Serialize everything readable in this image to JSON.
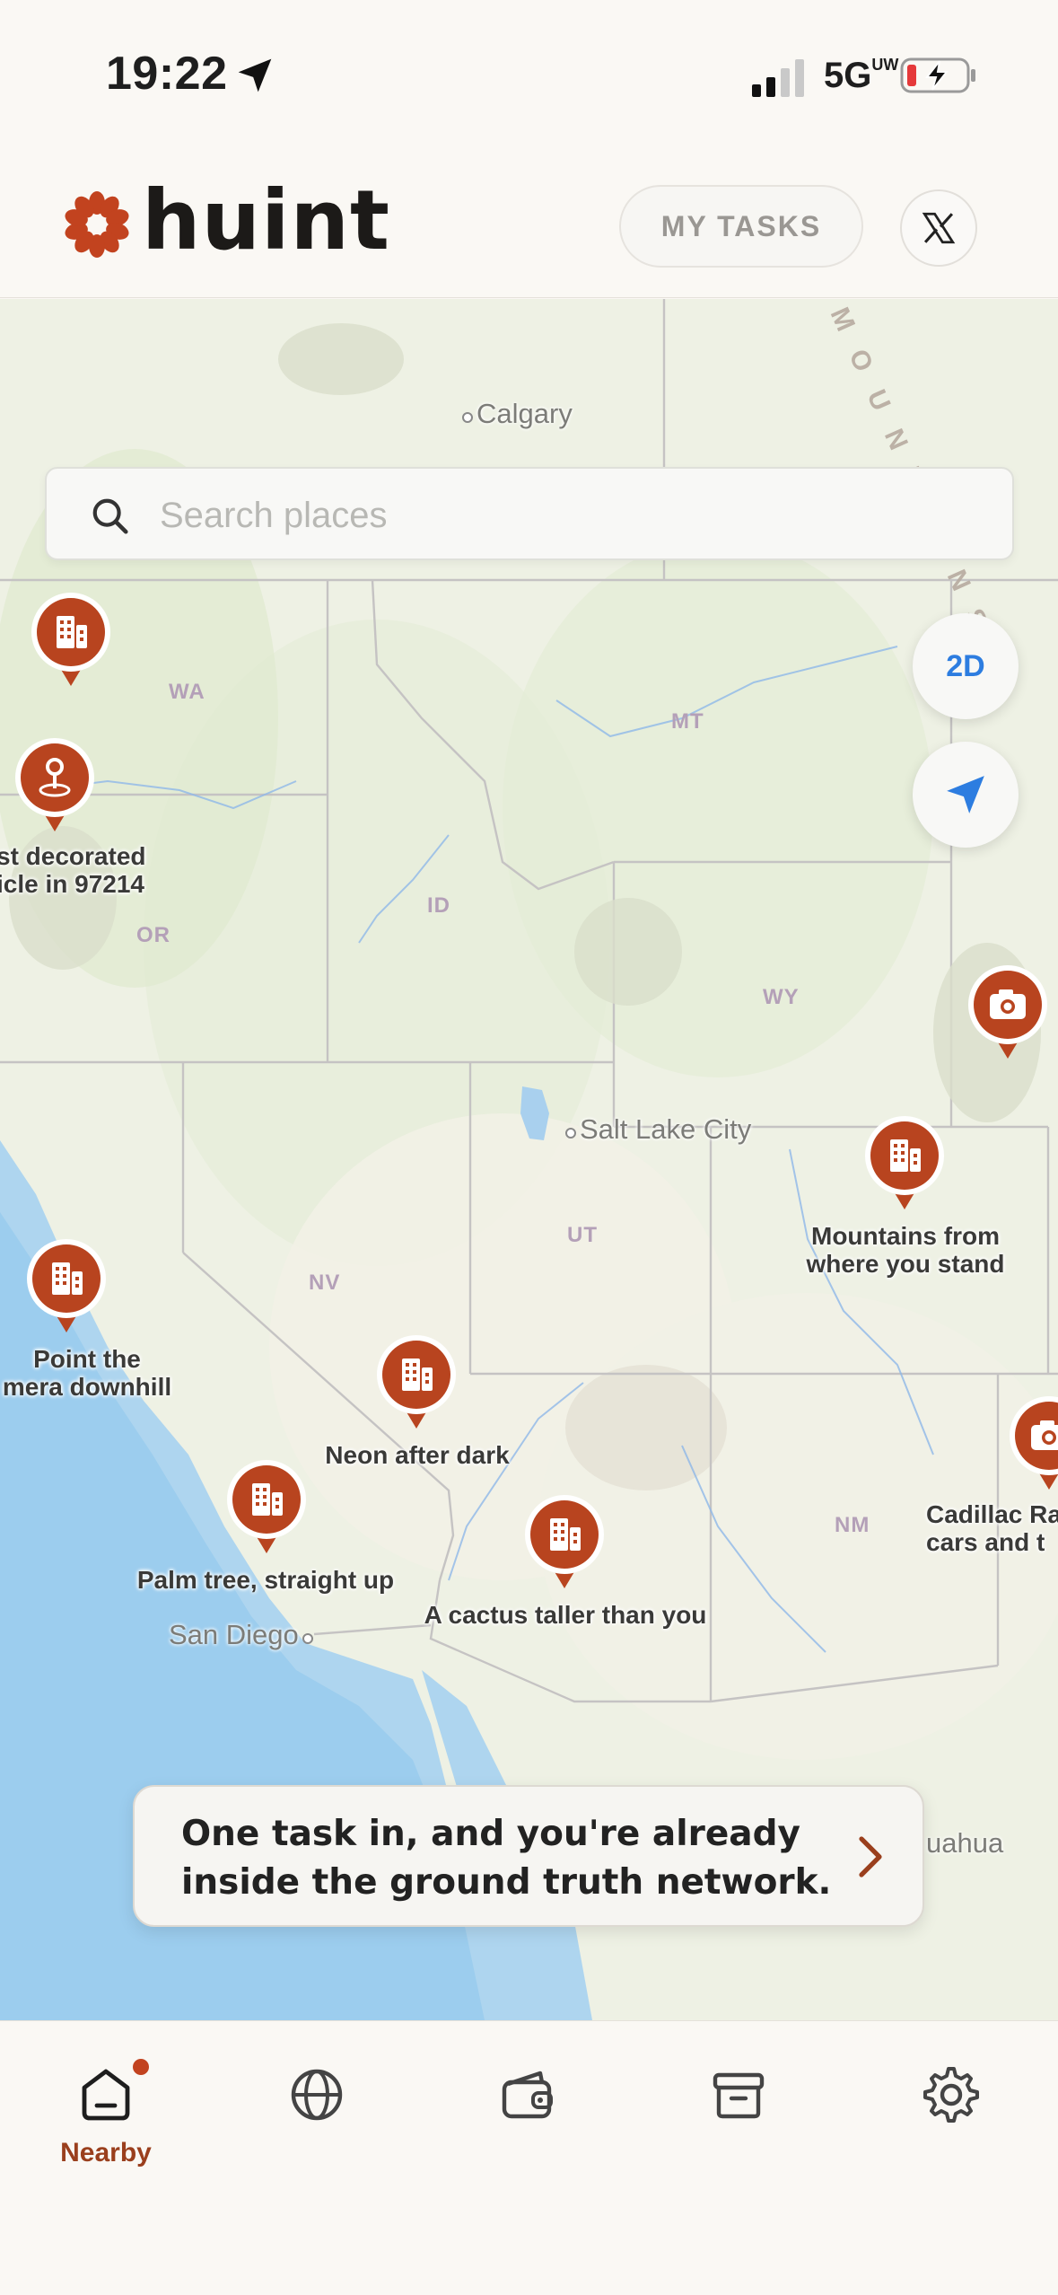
{
  "status_bar": {
    "time": "19:22",
    "network": "5G",
    "network_suffix": "UW",
    "battery_state": "low-charging"
  },
  "header": {
    "app_name": "huint",
    "my_tasks_label": "MY TASKS",
    "x_icon": "x-logo-icon"
  },
  "search": {
    "placeholder": "Search places"
  },
  "map_controls": {
    "view_mode_label": "2D",
    "locate_icon": "navigation-arrow-icon"
  },
  "map": {
    "places": [
      "Calgary",
      "Salt Lake City",
      "San Diego",
      "uahua"
    ],
    "states": [
      "WA",
      "OR",
      "ID",
      "MT",
      "WY",
      "NV",
      "UT",
      "NM"
    ],
    "mountains_label": "ROCKY MOUNTAINS",
    "pins": [
      {
        "icon": "building-icon",
        "label": ""
      },
      {
        "icon": "pin-drop-icon",
        "label": "st decorated\nicle in 97214"
      },
      {
        "icon": "camera-icon",
        "label": ""
      },
      {
        "icon": "building-icon",
        "label": "Mountains from\nwhere you stand"
      },
      {
        "icon": "building-icon",
        "label": "Point the\nmera downhill"
      },
      {
        "icon": "building-icon",
        "label": "Neon after dark"
      },
      {
        "icon": "building-icon",
        "label": "Palm tree, straight up"
      },
      {
        "icon": "building-icon",
        "label": "A cactus taller than you"
      },
      {
        "icon": "camera-icon",
        "label": "Cadillac Ra\ncars and t"
      }
    ]
  },
  "banner": {
    "text": "One task in, and you're already inside the ground truth network."
  },
  "tabs": [
    {
      "icon": "home-icon",
      "label": "Nearby",
      "active": true,
      "badge": true
    },
    {
      "icon": "globe-icon",
      "label": ""
    },
    {
      "icon": "wallet-icon",
      "label": ""
    },
    {
      "icon": "archive-icon",
      "label": ""
    },
    {
      "icon": "gear-icon",
      "label": ""
    }
  ],
  "colors": {
    "brand": "#b8441f",
    "accent_blue": "#2d7de0",
    "background": "#faf8f4"
  }
}
